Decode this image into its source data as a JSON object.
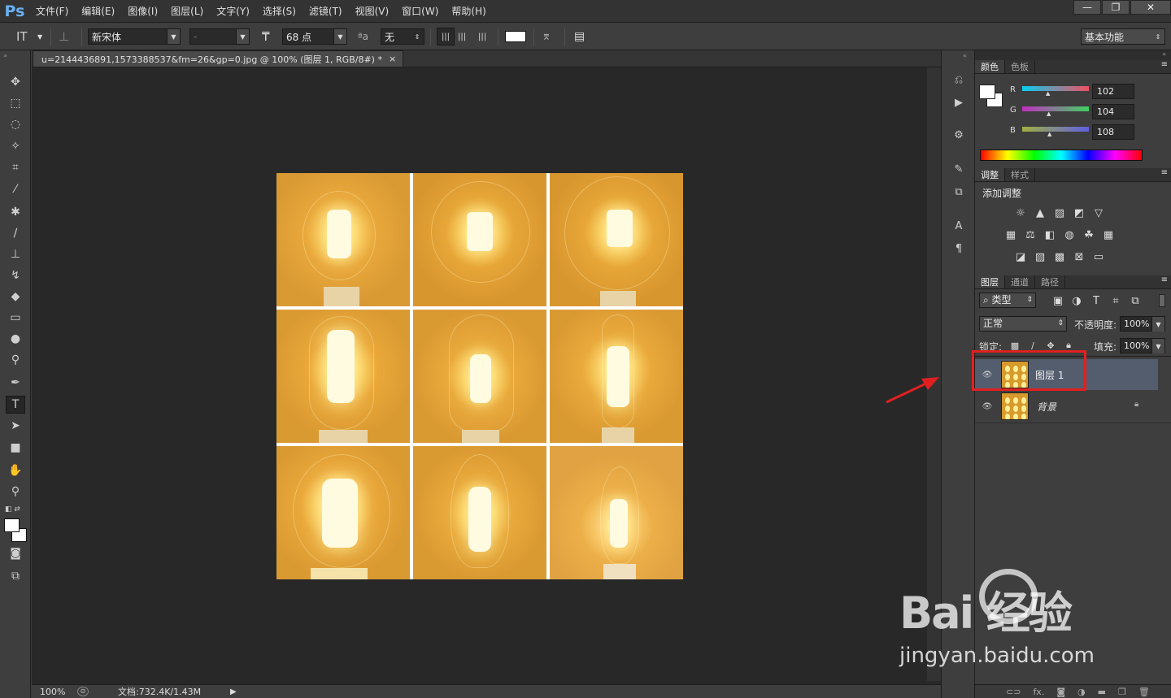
{
  "app": {
    "logo": "Ps"
  },
  "menu": [
    "文件(F)",
    "编辑(E)",
    "图像(I)",
    "图层(L)",
    "文字(Y)",
    "选择(S)",
    "滤镜(T)",
    "视图(V)",
    "窗口(W)",
    "帮助(H)"
  ],
  "window_controls": {
    "minimize": "—",
    "restore": "❐",
    "close": "✕"
  },
  "options": {
    "tool_icon": "IT",
    "font_family": "新宋体",
    "font_style": "-",
    "font_size": "68 点",
    "aa_label": "ªa",
    "aa_value": "无",
    "workspace": "基本功能"
  },
  "document": {
    "tab_title": "u=2144436891,1573388537&fm=26&gp=0.jpg @ 100% (图层 1, RGB/8#) *",
    "tab_close": "×",
    "zoom": "100%",
    "doc_info": "文档:732.4K/1.43M"
  },
  "color_panel": {
    "tabs": [
      "颜色",
      "色板"
    ],
    "r_label": "R",
    "r": "102",
    "g_label": "G",
    "g": "104",
    "b_label": "B",
    "b": "108"
  },
  "adjust_panel": {
    "tabs": [
      "调整",
      "样式"
    ],
    "title": "添加调整"
  },
  "layers_panel": {
    "tabs": [
      "图层",
      "通道",
      "路径"
    ],
    "filter": "类型",
    "blend_mode": "正常",
    "opacity_label": "不透明度:",
    "opacity": "100%",
    "lock_label": "锁定:",
    "fill_label": "填充:",
    "fill": "100%",
    "layers": [
      {
        "name": "图层 1",
        "selected": true
      },
      {
        "name": "背景",
        "locked": true
      }
    ],
    "bottom_icons": [
      "link-icon",
      "fx-icon",
      "mask-icon",
      "adjustment-icon",
      "group-icon",
      "new-layer-icon",
      "trash-icon"
    ],
    "fx_text": "fx."
  },
  "watermark": {
    "brand": "Bai 经验",
    "url": "jingyan.baidu.com"
  },
  "colors": {
    "accent_red": "#e02020",
    "ps_blue": "#6ab0f3",
    "layer_selected": "#535d6e",
    "bulb_bg": "#d89a2c"
  }
}
